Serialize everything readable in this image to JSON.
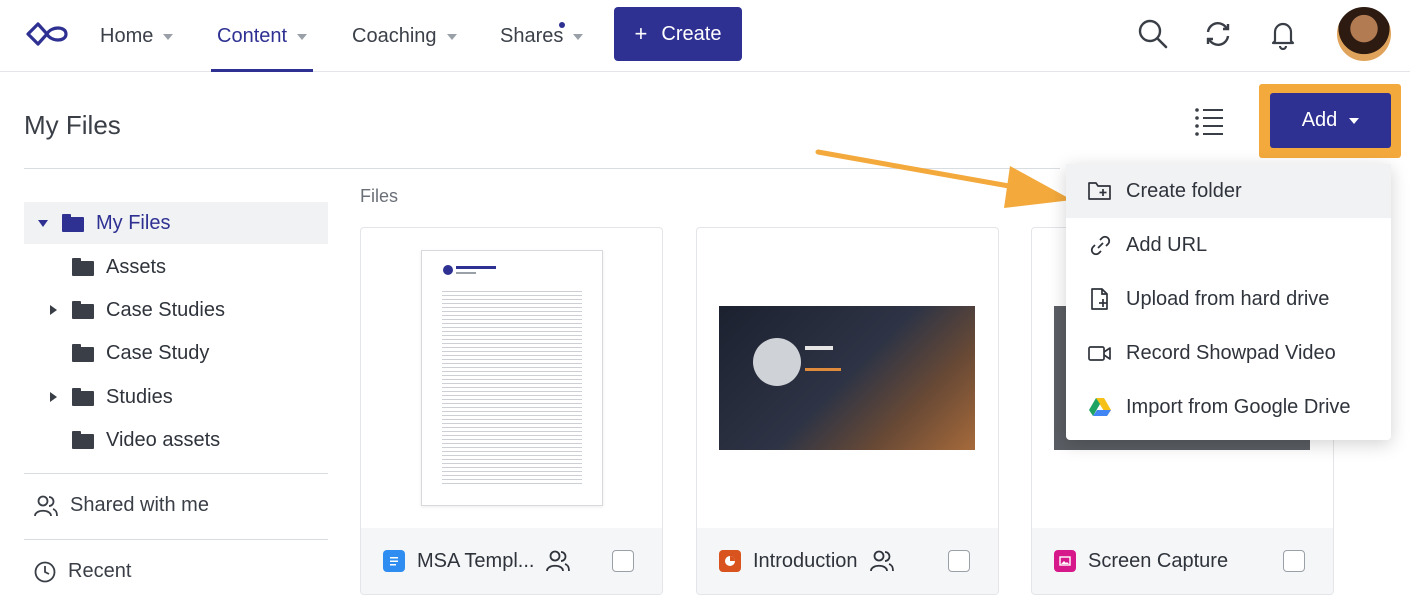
{
  "nav": {
    "items": [
      {
        "label": "Home"
      },
      {
        "label": "Content"
      },
      {
        "label": "Coaching"
      },
      {
        "label": "Shares"
      }
    ],
    "create_label": "Create"
  },
  "header": {
    "title": "My Files",
    "add_label": "Add"
  },
  "sidebar": {
    "root": "My Files",
    "folders": [
      "Assets",
      "Case Studies",
      "Case Study",
      "Studies",
      "Video assets"
    ],
    "shared": "Shared with me",
    "recent": "Recent"
  },
  "files": {
    "section_label": "Files",
    "cards": [
      {
        "name": "MSA Templ...",
        "type": "document"
      },
      {
        "name": "Introduction",
        "type": "presentation"
      },
      {
        "name": "Screen Capture",
        "type": "image"
      }
    ]
  },
  "add_menu": {
    "items": [
      {
        "label": "Create folder"
      },
      {
        "label": "Add URL"
      },
      {
        "label": "Upload from hard drive"
      },
      {
        "label": "Record Showpad Video"
      },
      {
        "label": "Import from Google Drive"
      }
    ]
  },
  "colors": {
    "brand": "#2e3192",
    "highlight": "#f3a93c",
    "doc": "#2f8cf0",
    "presentation": "#d9531e",
    "image": "#d6188a"
  }
}
